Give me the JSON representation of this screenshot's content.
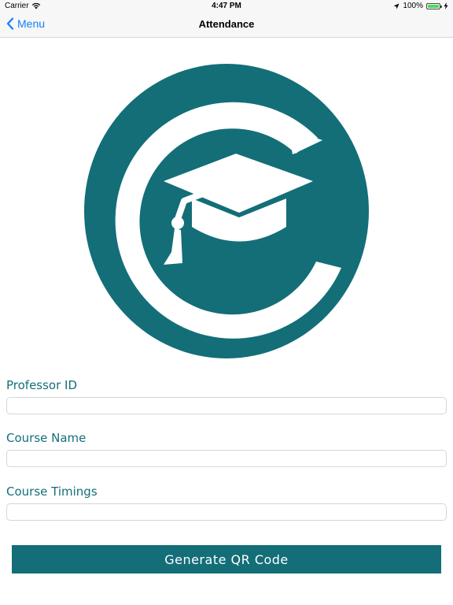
{
  "status_bar": {
    "carrier": "Carrier",
    "time": "4:47 PM",
    "battery": "100%"
  },
  "nav": {
    "back_label": "Menu",
    "title": "Attendance"
  },
  "form": {
    "professor_id_label": "Professor ID",
    "professor_id_value": "",
    "course_name_label": "Course Name",
    "course_name_value": "",
    "course_timings_label": "Course Timings",
    "course_timings_value": ""
  },
  "actions": {
    "generate_label": "Generate QR Code"
  },
  "colors": {
    "brand": "#136e78",
    "ios_blue": "#157efb"
  },
  "icons": {
    "logo": "graduation-cap-icon"
  }
}
